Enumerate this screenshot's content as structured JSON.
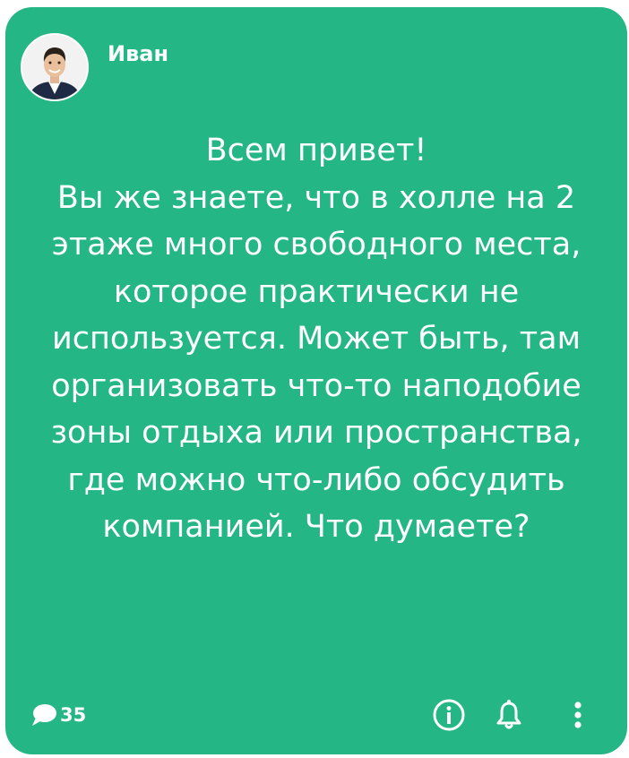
{
  "post": {
    "author": "Иван",
    "text": "Всем привет!\nВы же знаете, что в холле на 2 этаже много свободного места, которое практически не используется. Может быть, там организовать что-то наподобие зоны отдыха или пространства, где можно что-либо обсудить компанией. Что думаете?",
    "comments_count": "35"
  },
  "colors": {
    "card_background": "#25b685",
    "text": "#ffffff"
  },
  "icons": {
    "comment": "speech-bubble",
    "info": "info-circle",
    "notifications": "bell",
    "more": "vertical-dots"
  }
}
